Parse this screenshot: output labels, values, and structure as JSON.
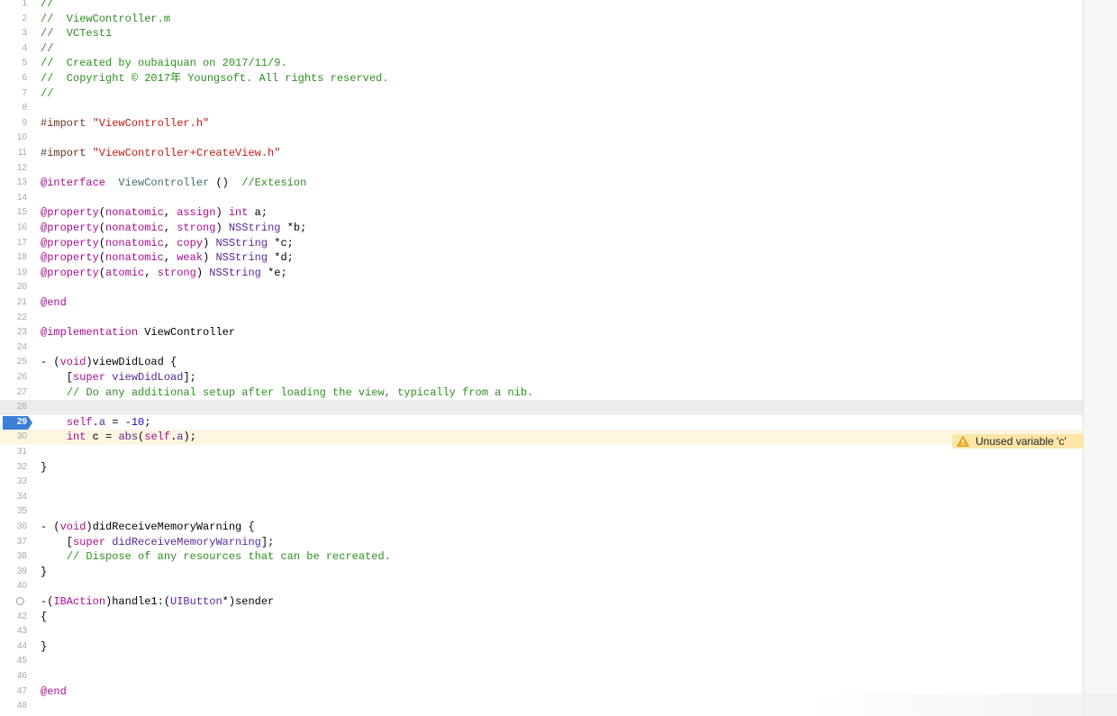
{
  "editor": {
    "lines": [
      {
        "n": "1",
        "t": [
          [
            "cm",
            "//"
          ]
        ]
      },
      {
        "n": "2",
        "t": [
          [
            "cm",
            "//  ViewController.m"
          ]
        ]
      },
      {
        "n": "3",
        "t": [
          [
            "cm",
            "//  VCTest1"
          ]
        ]
      },
      {
        "n": "4",
        "t": [
          [
            "cm",
            "//"
          ]
        ]
      },
      {
        "n": "5",
        "t": [
          [
            "cm",
            "//  Created by oubaiquan on 2017/11/9."
          ]
        ]
      },
      {
        "n": "6",
        "t": [
          [
            "cm",
            "//  Copyright © 2017年 Youngsoft. All rights reserved."
          ]
        ]
      },
      {
        "n": "7",
        "t": [
          [
            "cm",
            "//"
          ]
        ]
      },
      {
        "n": "8",
        "t": []
      },
      {
        "n": "9",
        "t": [
          [
            "pr",
            "#import "
          ],
          [
            "st",
            "\"ViewController.h\""
          ]
        ]
      },
      {
        "n": "10",
        "t": []
      },
      {
        "n": "11",
        "t": [
          [
            "pr",
            "#import "
          ],
          [
            "st",
            "\"ViewController+CreateView.h\""
          ]
        ]
      },
      {
        "n": "12",
        "t": []
      },
      {
        "n": "13",
        "t": [
          [
            "kw",
            "@interface"
          ],
          [
            "",
            "  "
          ],
          [
            "cls",
            "ViewController"
          ],
          [
            "",
            " ()  "
          ],
          [
            "cm",
            "//Extesion"
          ]
        ]
      },
      {
        "n": "14",
        "t": []
      },
      {
        "n": "15",
        "t": [
          [
            "kw",
            "@property"
          ],
          [
            "",
            "("
          ],
          [
            "kw",
            "nonatomic"
          ],
          [
            "",
            ", "
          ],
          [
            "kw",
            "assign"
          ],
          [
            "",
            ") "
          ],
          [
            "kw",
            "int"
          ],
          [
            "",
            " a;"
          ]
        ]
      },
      {
        "n": "16",
        "t": [
          [
            "kw",
            "@property"
          ],
          [
            "",
            "("
          ],
          [
            "kw",
            "nonatomic"
          ],
          [
            "",
            ", "
          ],
          [
            "kw",
            "strong"
          ],
          [
            "",
            ") "
          ],
          [
            "nt",
            "NSString"
          ],
          [
            "",
            " *b;"
          ]
        ]
      },
      {
        "n": "17",
        "t": [
          [
            "kw",
            "@property"
          ],
          [
            "",
            "("
          ],
          [
            "kw",
            "nonatomic"
          ],
          [
            "",
            ", "
          ],
          [
            "kw",
            "copy"
          ],
          [
            "",
            ") "
          ],
          [
            "nt",
            "NSString"
          ],
          [
            "",
            " *c;"
          ]
        ]
      },
      {
        "n": "18",
        "t": [
          [
            "kw",
            "@property"
          ],
          [
            "",
            "("
          ],
          [
            "kw",
            "nonatomic"
          ],
          [
            "",
            ", "
          ],
          [
            "kw",
            "weak"
          ],
          [
            "",
            ") "
          ],
          [
            "nt",
            "NSString"
          ],
          [
            "",
            " *d;"
          ]
        ]
      },
      {
        "n": "19",
        "t": [
          [
            "kw",
            "@property"
          ],
          [
            "",
            "("
          ],
          [
            "kw",
            "atomic"
          ],
          [
            "",
            ", "
          ],
          [
            "kw",
            "strong"
          ],
          [
            "",
            ") "
          ],
          [
            "nt",
            "NSString"
          ],
          [
            "",
            " *e;"
          ]
        ]
      },
      {
        "n": "20",
        "t": []
      },
      {
        "n": "21",
        "t": [
          [
            "kw",
            "@end"
          ]
        ]
      },
      {
        "n": "22",
        "t": []
      },
      {
        "n": "23",
        "t": [
          [
            "kw",
            "@implementation"
          ],
          [
            "",
            " ViewController"
          ]
        ]
      },
      {
        "n": "24",
        "t": []
      },
      {
        "n": "25",
        "t": [
          [
            "",
            "- ("
          ],
          [
            "kw",
            "void"
          ],
          [
            "",
            ")viewDidLoad {"
          ]
        ]
      },
      {
        "n": "26",
        "t": [
          [
            "",
            "    ["
          ],
          [
            "kw",
            "super"
          ],
          [
            "",
            " "
          ],
          [
            "nt",
            "viewDidLoad"
          ],
          [
            "",
            "];"
          ]
        ]
      },
      {
        "n": "27",
        "t": [
          [
            "",
            "    "
          ],
          [
            "cm",
            "// Do any additional setup after loading the view, typically from a nib."
          ]
        ]
      },
      {
        "n": "28",
        "t": [],
        "current": true
      },
      {
        "n": "29",
        "t": [
          [
            "",
            "    "
          ],
          [
            "kw",
            "self"
          ],
          [
            "",
            "."
          ],
          [
            "nt",
            "a"
          ],
          [
            "",
            " = -"
          ],
          [
            "num",
            "10"
          ],
          [
            "",
            ";"
          ]
        ],
        "breakpoint": true
      },
      {
        "n": "30",
        "t": [
          [
            "",
            "    "
          ],
          [
            "kw",
            "int"
          ],
          [
            "",
            " c = "
          ],
          [
            "nt",
            "abs"
          ],
          [
            "",
            "("
          ],
          [
            "kw",
            "self"
          ],
          [
            "",
            "."
          ],
          [
            "nt",
            "a"
          ],
          [
            "",
            ");"
          ]
        ],
        "warning": true
      },
      {
        "n": "31",
        "t": []
      },
      {
        "n": "32",
        "t": [
          [
            "",
            "}"
          ]
        ]
      },
      {
        "n": "33",
        "t": []
      },
      {
        "n": "34",
        "t": []
      },
      {
        "n": "35",
        "t": []
      },
      {
        "n": "36",
        "t": [
          [
            "",
            "- ("
          ],
          [
            "kw",
            "void"
          ],
          [
            "",
            ")didReceiveMemoryWarning {"
          ]
        ]
      },
      {
        "n": "37",
        "t": [
          [
            "",
            "    ["
          ],
          [
            "kw",
            "super"
          ],
          [
            "",
            " "
          ],
          [
            "nt",
            "didReceiveMemoryWarning"
          ],
          [
            "",
            "];"
          ]
        ]
      },
      {
        "n": "38",
        "t": [
          [
            "",
            "    "
          ],
          [
            "cm",
            "// Dispose of any resources that can be recreated."
          ]
        ]
      },
      {
        "n": "39",
        "t": [
          [
            "",
            "}"
          ]
        ]
      },
      {
        "n": "40",
        "t": []
      },
      {
        "n": "41",
        "t": [
          [
            "",
            "-("
          ],
          [
            "kw",
            "IBAction"
          ],
          [
            "",
            ")handle1:("
          ],
          [
            "nt",
            "UIButton"
          ],
          [
            "",
            "*)sender"
          ]
        ],
        "ibaction": true
      },
      {
        "n": "42",
        "t": [
          [
            "",
            "{"
          ]
        ]
      },
      {
        "n": "43",
        "t": []
      },
      {
        "n": "44",
        "t": [
          [
            "",
            "}"
          ]
        ]
      },
      {
        "n": "45",
        "t": []
      },
      {
        "n": "46",
        "t": []
      },
      {
        "n": "47",
        "t": [
          [
            "kw",
            "@end"
          ]
        ]
      },
      {
        "n": "48",
        "t": []
      }
    ]
  },
  "warning": {
    "message": "Unused variable 'c'",
    "icon": "warning-triangle-icon"
  },
  "colors": {
    "comment": "#2f8d21",
    "string": "#c41a16",
    "keyword": "#aa0d91",
    "type": "#5c2699",
    "number": "#1c00cf",
    "preprocessor": "#643820",
    "breakpoint": "#3b7fd8",
    "current_line": "#ececec",
    "warning_line": "#fdf6e1",
    "warning_badge": "#fbe6a8"
  }
}
